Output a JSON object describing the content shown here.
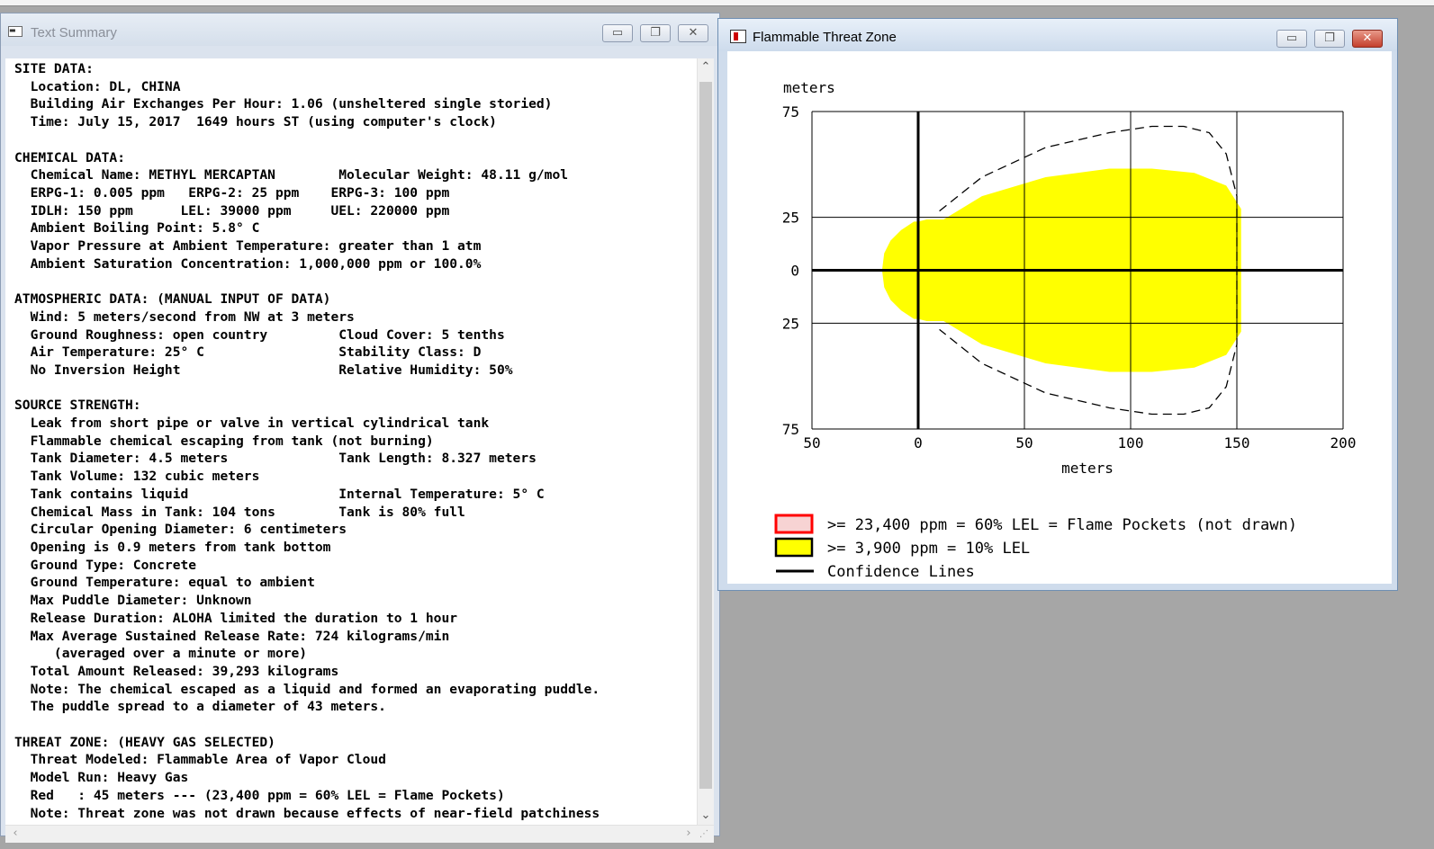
{
  "text_window": {
    "title": "Text Summary",
    "lines": [
      "SITE DATA:",
      "  Location: DL, CHINA",
      "  Building Air Exchanges Per Hour: 1.06 (unsheltered single storied)",
      "  Time: July 15, 2017  1649 hours ST (using computer's clock)",
      "",
      "CHEMICAL DATA:",
      "  Chemical Name: METHYL MERCAPTAN        Molecular Weight: 48.11 g/mol",
      "  ERPG-1: 0.005 ppm   ERPG-2: 25 ppm    ERPG-3: 100 ppm",
      "  IDLH: 150 ppm      LEL: 39000 ppm     UEL: 220000 ppm",
      "  Ambient Boiling Point: 5.8° C",
      "  Vapor Pressure at Ambient Temperature: greater than 1 atm",
      "  Ambient Saturation Concentration: 1,000,000 ppm or 100.0%",
      "",
      "ATMOSPHERIC DATA: (MANUAL INPUT OF DATA)",
      "  Wind: 5 meters/second from NW at 3 meters",
      "  Ground Roughness: open country         Cloud Cover: 5 tenths",
      "  Air Temperature: 25° C                 Stability Class: D",
      "  No Inversion Height                    Relative Humidity: 50%",
      "",
      "SOURCE STRENGTH:",
      "  Leak from short pipe or valve in vertical cylindrical tank",
      "  Flammable chemical escaping from tank (not burning)",
      "  Tank Diameter: 4.5 meters              Tank Length: 8.327 meters",
      "  Tank Volume: 132 cubic meters",
      "  Tank contains liquid                   Internal Temperature: 5° C",
      "  Chemical Mass in Tank: 104 tons        Tank is 80% full",
      "  Circular Opening Diameter: 6 centimeters",
      "  Opening is 0.9 meters from tank bottom",
      "  Ground Type: Concrete",
      "  Ground Temperature: equal to ambient",
      "  Max Puddle Diameter: Unknown",
      "  Release Duration: ALOHA limited the duration to 1 hour",
      "  Max Average Sustained Release Rate: 724 kilograms/min",
      "     (averaged over a minute or more)",
      "  Total Amount Released: 39,293 kilograms",
      "  Note: The chemical escaped as a liquid and formed an evaporating puddle.",
      "  The puddle spread to a diameter of 43 meters.",
      "",
      "THREAT ZONE: (HEAVY GAS SELECTED)",
      "  Threat Modeled: Flammable Area of Vapor Cloud",
      "  Model Run: Heavy Gas",
      "  Red   : 45 meters --- (23,400 ppm = 60% LEL = Flame Pockets)",
      "  Note: Threat zone was not drawn because effects of near-field patchiness"
    ]
  },
  "chart_window": {
    "title": "Flammable Threat Zone"
  },
  "chart_data": {
    "type": "area",
    "ylabel": "meters",
    "xlabel": "meters",
    "xlim": [
      -50,
      200
    ],
    "ylim": [
      -75,
      75
    ],
    "x_ticks": [
      "50",
      "0",
      "50",
      "100",
      "150",
      "200"
    ],
    "y_ticks": [
      "75",
      "25",
      "0",
      "25",
      "75"
    ],
    "series": [
      {
        "name": ">= 3,900 ppm = 10% LEL",
        "color": "#ffff00",
        "shape": "filled",
        "x": [
          -17,
          -16,
          -13,
          -8,
          -2,
          0,
          4,
          12,
          30,
          60,
          90,
          110,
          130,
          145,
          152,
          152,
          145,
          130,
          110,
          90,
          60,
          30,
          12,
          4,
          0,
          -2,
          -8,
          -13,
          -16,
          -17
        ],
        "y": [
          0,
          8,
          14,
          19,
          23,
          23,
          24,
          24,
          35,
          44,
          48,
          48,
          46,
          40,
          29,
          -29,
          -40,
          -46,
          -48,
          -48,
          -44,
          -35,
          -24,
          -24,
          -23,
          -23,
          -19,
          -14,
          -8,
          0
        ]
      },
      {
        "name": "Confidence Lines",
        "color": "#000000",
        "shape": "dashed",
        "x": [
          10,
          30,
          60,
          90,
          110,
          125,
          137,
          145,
          150,
          150,
          145,
          137,
          125,
          110,
          90,
          60,
          30,
          10
        ],
        "y": [
          28,
          44,
          58,
          65,
          68,
          68,
          65,
          55,
          35,
          -35,
          -55,
          -65,
          -68,
          -68,
          -65,
          -58,
          -44,
          -28
        ]
      }
    ],
    "legend": [
      {
        "label": ">= 23,400 ppm = 60% LEL = Flame Pockets (not drawn)",
        "kind": "pocket",
        "color": "#ff0000"
      },
      {
        "label": ">= 3,900 ppm = 10% LEL",
        "kind": "fill",
        "color": "#ffff00"
      },
      {
        "label": "Confidence Lines",
        "kind": "line",
        "color": "#000000"
      }
    ],
    "grid": true
  }
}
